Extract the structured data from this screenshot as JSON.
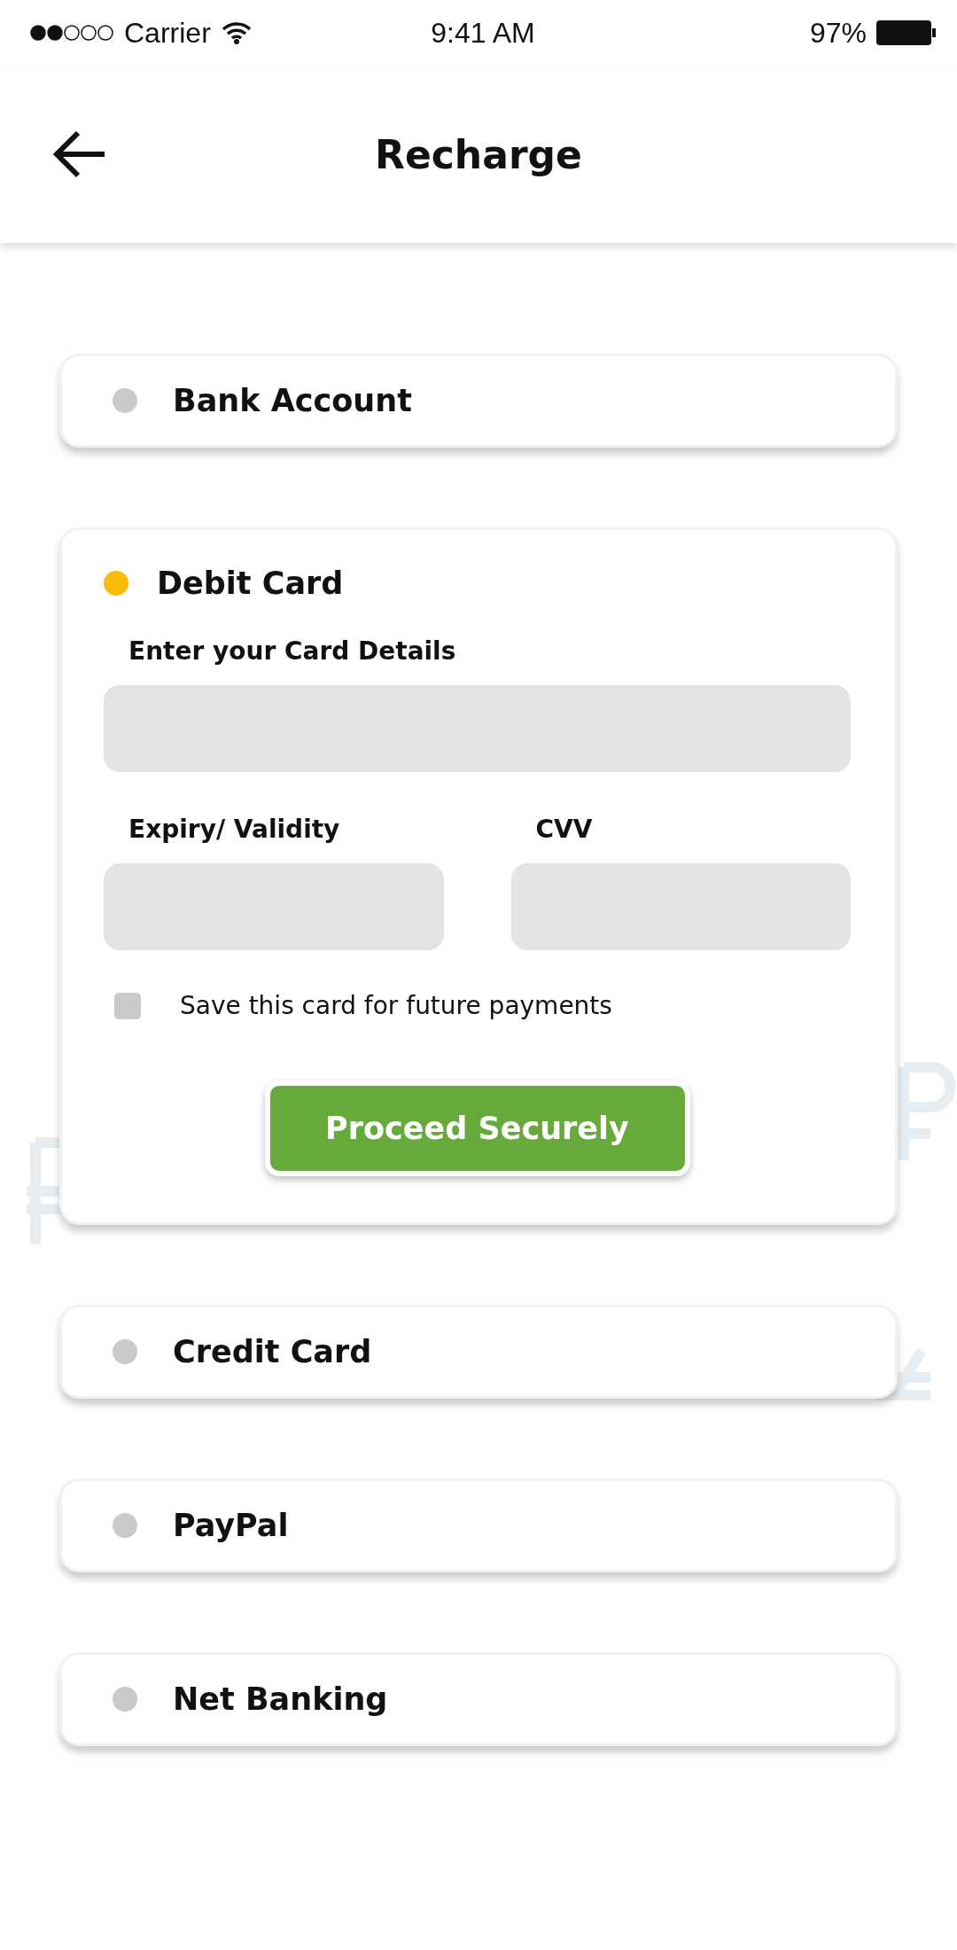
{
  "status_bar": {
    "carrier": "Carrier",
    "time": "9:41 AM",
    "battery": "97%"
  },
  "header": {
    "title": "Recharge"
  },
  "payment_methods": [
    {
      "kind": "collapsed",
      "label": "Bank Account",
      "selected": false
    },
    {
      "kind": "expanded",
      "label": "Debit Card",
      "selected": true,
      "form": {
        "card_label": "Enter your Card Details",
        "expiry_label": "Expiry/ Validity",
        "cvv_label": "CVV",
        "save_card": {
          "label": "Save this card for future payments",
          "checked": false
        },
        "submit": "Proceed Securely"
      }
    },
    {
      "kind": "collapsed",
      "label": "Credit Card",
      "selected": false
    },
    {
      "kind": "collapsed",
      "label": "PayPal",
      "selected": false
    },
    {
      "kind": "collapsed",
      "label": "Net Banking",
      "selected": false
    }
  ]
}
